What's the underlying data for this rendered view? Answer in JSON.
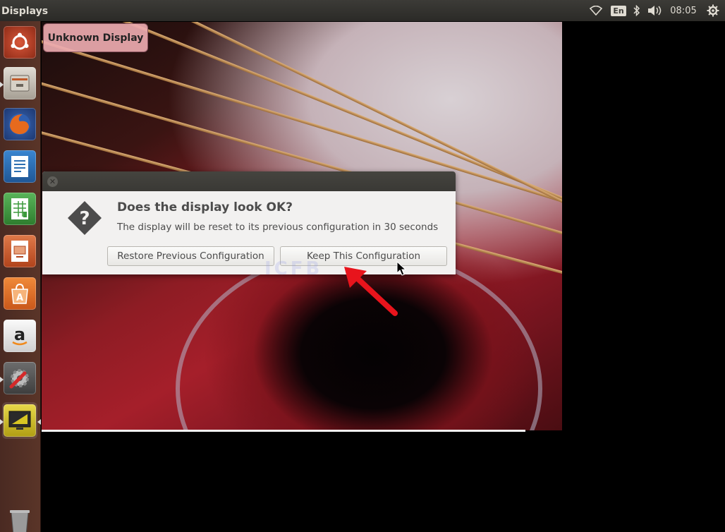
{
  "panel": {
    "title": "Displays",
    "language": "En",
    "clock": "08:05",
    "icons": [
      "wifi-icon",
      "bluetooth-icon",
      "volume-icon",
      "power-gear-icon"
    ]
  },
  "launcher": {
    "items": [
      {
        "name": "ubuntu-dash-icon",
        "color": "#c9502f"
      },
      {
        "name": "files-icon",
        "color": "#b8b2a8"
      },
      {
        "name": "firefox-icon",
        "color": "#e66a1d"
      },
      {
        "name": "writer-icon",
        "color": "#2d6fb1"
      },
      {
        "name": "calc-icon",
        "color": "#3c9a3c"
      },
      {
        "name": "impress-icon",
        "color": "#c9502f"
      },
      {
        "name": "software-center-icon",
        "color": "#e8762d"
      },
      {
        "name": "amazon-icon",
        "color": "#f0f0f0"
      },
      {
        "name": "system-settings-icon",
        "color": "#c22d2d"
      },
      {
        "name": "displays-icon",
        "color": "#d7c623"
      },
      {
        "name": "trash-icon",
        "color": "#8a8a8a"
      }
    ]
  },
  "display_label": "Unknown Display",
  "dialog": {
    "heading": "Does the display look OK?",
    "body": "The display will be reset to its previous configuration in 30 seconds",
    "restore_label": "Restore Previous Configuration",
    "keep_label": "Keep This Configuration"
  },
  "accent": {
    "arrow": "#e8141c",
    "panel": "#3c3b37"
  }
}
